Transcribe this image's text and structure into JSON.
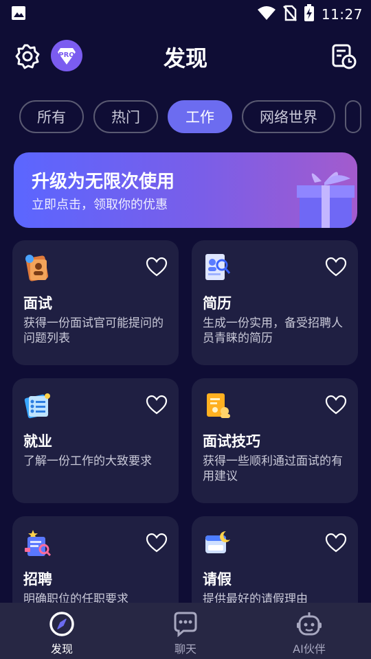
{
  "status": {
    "time": "11:27"
  },
  "header": {
    "title": "发现"
  },
  "tabs": [
    {
      "label": "所有"
    },
    {
      "label": "热门"
    },
    {
      "label": "工作"
    },
    {
      "label": "网络世界"
    }
  ],
  "banner": {
    "title": "升级为无限次使用",
    "subtitle": "立即点击，领取你的优惠"
  },
  "cards": [
    {
      "title": "面试",
      "desc": "获得一份面试官可能提问的问题列表"
    },
    {
      "title": "简历",
      "desc": "生成一份实用，备受招聘人员青睐的简历"
    },
    {
      "title": "就业",
      "desc": "了解一份工作的大致要求"
    },
    {
      "title": "面试技巧",
      "desc": "获得一些顺利通过面试的有用建议"
    },
    {
      "title": "招聘",
      "desc": "明确职位的任职要求"
    },
    {
      "title": "请假",
      "desc": "提供最好的请假理由"
    }
  ],
  "nav": [
    {
      "label": "发现"
    },
    {
      "label": "聊天"
    },
    {
      "label": "AI伙伴"
    }
  ],
  "colors": {
    "background": "#0f0d35",
    "accent": "#6c6cf0",
    "card": "#1f1f42"
  }
}
